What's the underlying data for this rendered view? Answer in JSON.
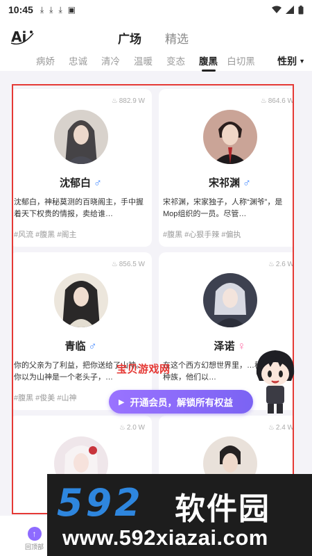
{
  "status": {
    "time": "10:45"
  },
  "header": {
    "tabs": [
      "广场",
      "精选"
    ]
  },
  "categories": [
    "病娇",
    "忠诚",
    "清冷",
    "温暖",
    "变态",
    "腹黑",
    "白切黑"
  ],
  "gender_filter": "性别",
  "cards": [
    {
      "heat": "882.9 W",
      "name": "沈郁白",
      "sex": "♂",
      "desc": "沈郁白，神秘莫测的百晓阁主，手中握着天下权贵的情报，卖给谁…",
      "tags": "#风流 #腹黑 #阁主"
    },
    {
      "heat": "864.6 W",
      "name": "宋祁渊",
      "sex": "♂",
      "desc": "宋祁渊，宋家独子，人称“渊爷”，是Mop组织的一员。尽管…",
      "tags": "#腹黑 #心狠手辣 #偏执"
    },
    {
      "heat": "856.5 W",
      "name": "青临",
      "sex": "♂",
      "desc": "你的父亲为了利益，把你送给了山神。你以为山神是一个老头子，…",
      "tags": "#腹黑 #俊美 #山神"
    },
    {
      "heat": "2.6 W",
      "name": "泽诺",
      "sex": "♀",
      "desc": "在这个西方幻想世界里，…称为恶魔的种族，他们以…",
      "tags": ""
    },
    {
      "heat": "2.0 W",
      "name": "",
      "sex": "",
      "desc": "",
      "tags": ""
    },
    {
      "heat": "2.4 W",
      "name": "",
      "sex": "",
      "desc": "",
      "tags": ""
    }
  ],
  "vip_banner": "开通会员，解锁所有权益",
  "watermark_small": "宝贝游戏网",
  "bottom": {
    "top_label": "回顶部"
  },
  "watermark": {
    "big": "592",
    "cn": "软件园",
    "url": "www.592xiazai.com"
  }
}
